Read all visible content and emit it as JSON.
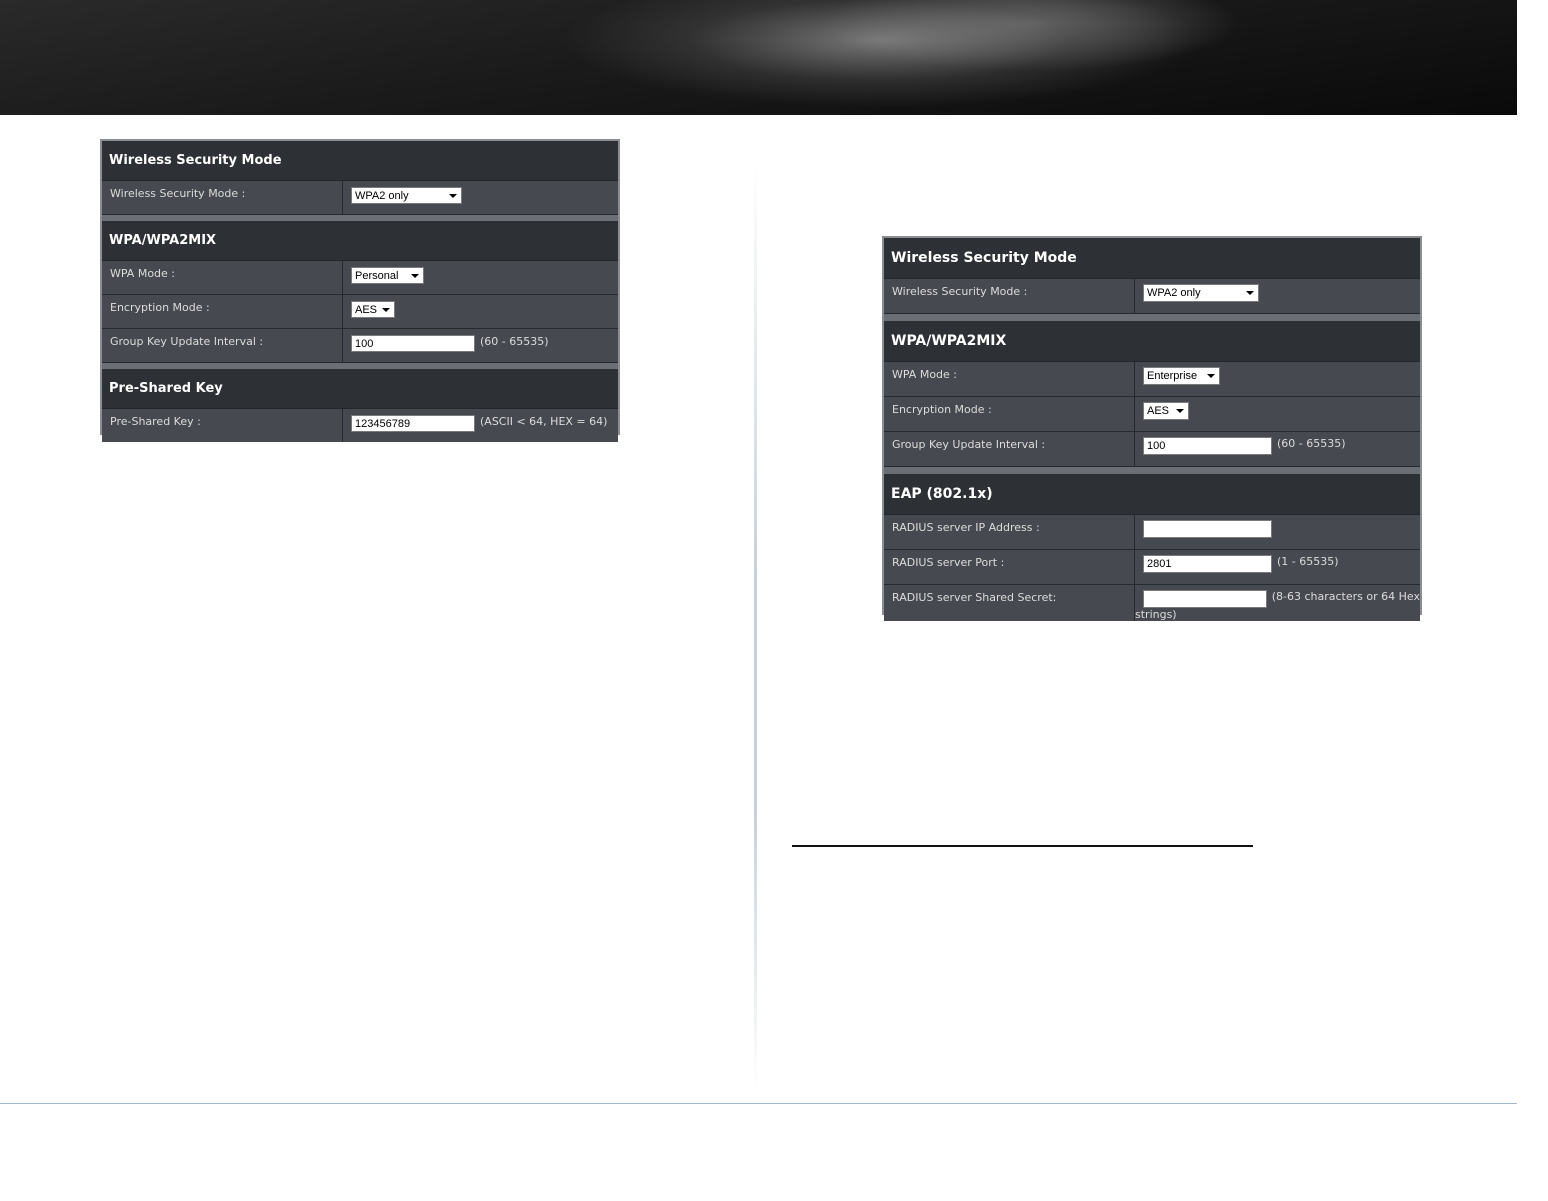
{
  "left_panel": {
    "section1_title": "Wireless Security Mode",
    "security_mode_label": "Wireless Security Mode :",
    "security_mode_value": "WPA2 only",
    "section2_title": "WPA/WPA2MIX",
    "wpa_mode_label": "WPA Mode :",
    "wpa_mode_value": "Personal",
    "encryption_label": "Encryption Mode :",
    "encryption_value": "AES",
    "group_key_label": "Group Key Update Interval :",
    "group_key_value": "100",
    "group_key_hint": "(60 - 65535)",
    "section3_title": "Pre-Shared Key",
    "psk_label": "Pre-Shared Key :",
    "psk_value": "123456789",
    "psk_hint": "(ASCII < 64, HEX = 64)"
  },
  "right_panel": {
    "section1_title": "Wireless Security Mode",
    "security_mode_label": "Wireless Security Mode :",
    "security_mode_value": "WPA2 only",
    "section2_title": "WPA/WPA2MIX",
    "wpa_mode_label": "WPA Mode :",
    "wpa_mode_value": "Enterprise",
    "encryption_label": "Encryption Mode :",
    "encryption_value": "AES",
    "group_key_label": "Group Key Update Interval :",
    "group_key_value": "100",
    "group_key_hint": "(60 - 65535)",
    "section3_title": "EAP (802.1x)",
    "radius_ip_label": "RADIUS server IP Address :",
    "radius_ip_value": "",
    "radius_port_label": "RADIUS server Port :",
    "radius_port_value": "2801",
    "radius_port_hint": "(1 - 65535)",
    "radius_secret_label": "RADIUS server Shared Secret:",
    "radius_secret_value": "",
    "radius_secret_hint": "(8-63 characters or 64 Hex",
    "radius_secret_hint_wrap": "strings)"
  },
  "colors": {
    "panel_bg": "#46494f",
    "section_head_bg": "#2d3035",
    "footer_line": "#9fb7d3"
  }
}
